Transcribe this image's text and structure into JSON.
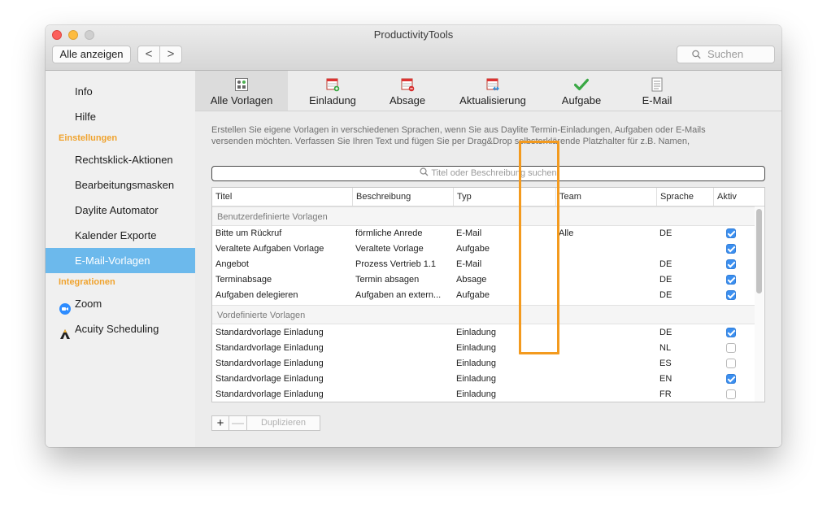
{
  "window": {
    "title": "ProductivityTools"
  },
  "toolbar": {
    "show_all": "Alle anzeigen",
    "back": "<",
    "forward": ">",
    "search_placeholder": "Suchen"
  },
  "sidebar": {
    "items_top": [
      {
        "label": "Info"
      },
      {
        "label": "Hilfe"
      }
    ],
    "section_settings": "Einstellungen",
    "settings_items": [
      {
        "label": "Rechtsklick-Aktionen"
      },
      {
        "label": "Bearbeitungsmasken"
      },
      {
        "label": "Daylite Automator"
      },
      {
        "label": "Kalender Exporte"
      },
      {
        "label": "E-Mail-Vorlagen"
      }
    ],
    "section_integrations": "Integrationen",
    "integration_items": [
      {
        "label": "Zoom",
        "icon": "zoom-icon"
      },
      {
        "label": "Acuity Scheduling",
        "icon": "acuity-icon"
      }
    ]
  },
  "tabs": [
    {
      "label": "Alle Vorlagen",
      "icon": "all-templates-icon"
    },
    {
      "label": "Einladung",
      "icon": "invitation-icon"
    },
    {
      "label": "Absage",
      "icon": "cancellation-icon"
    },
    {
      "label": "Aktualisierung",
      "icon": "update-icon"
    },
    {
      "label": "Aufgabe",
      "icon": "task-checkmark-icon"
    },
    {
      "label": "E-Mail",
      "icon": "email-document-icon"
    }
  ],
  "description": {
    "line1": "Erstellen Sie eigene Vorlagen in verschiedenen Sprachen, wenn Sie aus Daylite Termin-Einladungen, Aufgaben oder E-Mails",
    "line2": "versenden möchten. Verfassen Sie Ihren Text und fügen Sie per Drag&Drop selbsterklärende Platzhalter für z.B. Namen,"
  },
  "filter": {
    "placeholder": "Titel oder Beschreibung suchen"
  },
  "table": {
    "columns": {
      "title": "Titel",
      "desc": "Beschreibung",
      "type": "Typ",
      "team": "Team",
      "lang": "Sprache",
      "active": "Aktiv"
    },
    "group_custom": "Benutzerdefinierte Vorlagen",
    "custom_rows": [
      {
        "title": "Bitte um Rückruf",
        "desc": "förmliche Anrede",
        "type": "E-Mail",
        "team": "Alle",
        "lang": "DE",
        "active": true
      },
      {
        "title": "Veraltete Aufgaben Vorlage",
        "desc": "Veraltete Vorlage",
        "type": "Aufgabe",
        "team": "",
        "lang": "",
        "active": true
      },
      {
        "title": "Angebot",
        "desc": "Prozess Vertrieb 1.1",
        "type": "E-Mail",
        "team": "",
        "lang": "DE",
        "active": true
      },
      {
        "title": "Terminabsage",
        "desc": "Termin absagen",
        "type": "Absage",
        "team": "",
        "lang": "DE",
        "active": true
      },
      {
        "title": "Aufgaben delegieren",
        "desc": "Aufgaben an extern...",
        "type": "Aufgabe",
        "team": "",
        "lang": "DE",
        "active": true
      }
    ],
    "group_predefined": "Vordefinierte Vorlagen",
    "predefined_rows": [
      {
        "title": "Standardvorlage Einladung",
        "desc": "",
        "type": "Einladung",
        "team": "",
        "lang": "DE",
        "active": true
      },
      {
        "title": "Standardvorlage Einladung",
        "desc": "",
        "type": "Einladung",
        "team": "",
        "lang": "NL",
        "active": false
      },
      {
        "title": "Standardvorlage Einladung",
        "desc": "",
        "type": "Einladung",
        "team": "",
        "lang": "ES",
        "active": false
      },
      {
        "title": "Standardvorlage Einladung",
        "desc": "",
        "type": "Einladung",
        "team": "",
        "lang": "EN",
        "active": true
      },
      {
        "title": "Standardvorlage Einladung",
        "desc": "",
        "type": "Einladung",
        "team": "",
        "lang": "FR",
        "active": false
      }
    ]
  },
  "bottom_bar": {
    "add": "+",
    "remove": "—",
    "duplicate": "Duplizieren"
  },
  "colors": {
    "accent": "#6cb9ec",
    "section_header": "#f0a32e",
    "highlight": "#f39a1e",
    "checkbox_on": "#3b8ff0"
  }
}
